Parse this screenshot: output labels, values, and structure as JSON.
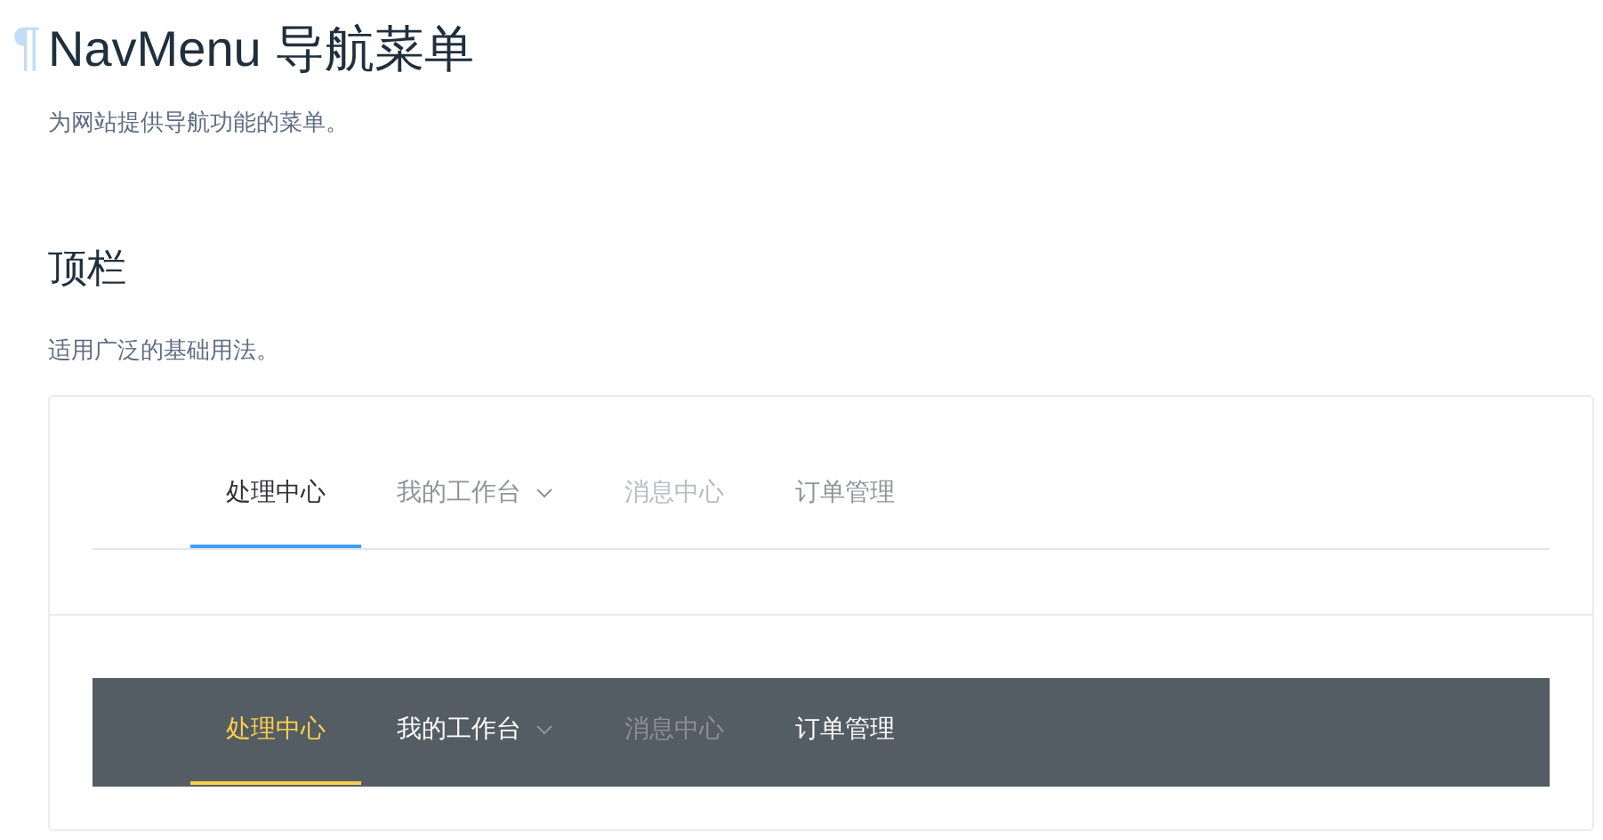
{
  "page": {
    "anchor": "¶",
    "title": "NavMenu 导航菜单",
    "description": "为网站提供导航功能的菜单。"
  },
  "section": {
    "title": "顶栏",
    "description": "适用广泛的基础用法。"
  },
  "menus": [
    {
      "kind": "light",
      "items": [
        {
          "label": "处理中心",
          "selected": true,
          "disabled": false,
          "submenu": false
        },
        {
          "label": "我的工作台",
          "selected": false,
          "disabled": false,
          "submenu": true
        },
        {
          "label": "消息中心",
          "selected": false,
          "disabled": true,
          "submenu": false
        },
        {
          "label": "订单管理",
          "selected": false,
          "disabled": false,
          "submenu": false
        }
      ]
    },
    {
      "kind": "dark",
      "items": [
        {
          "label": "处理中心",
          "selected": true,
          "disabled": false,
          "submenu": false
        },
        {
          "label": "我的工作台",
          "selected": false,
          "disabled": false,
          "submenu": true
        },
        {
          "label": "消息中心",
          "selected": false,
          "disabled": true,
          "submenu": false
        },
        {
          "label": "订单管理",
          "selected": false,
          "disabled": false,
          "submenu": false
        }
      ]
    }
  ]
}
